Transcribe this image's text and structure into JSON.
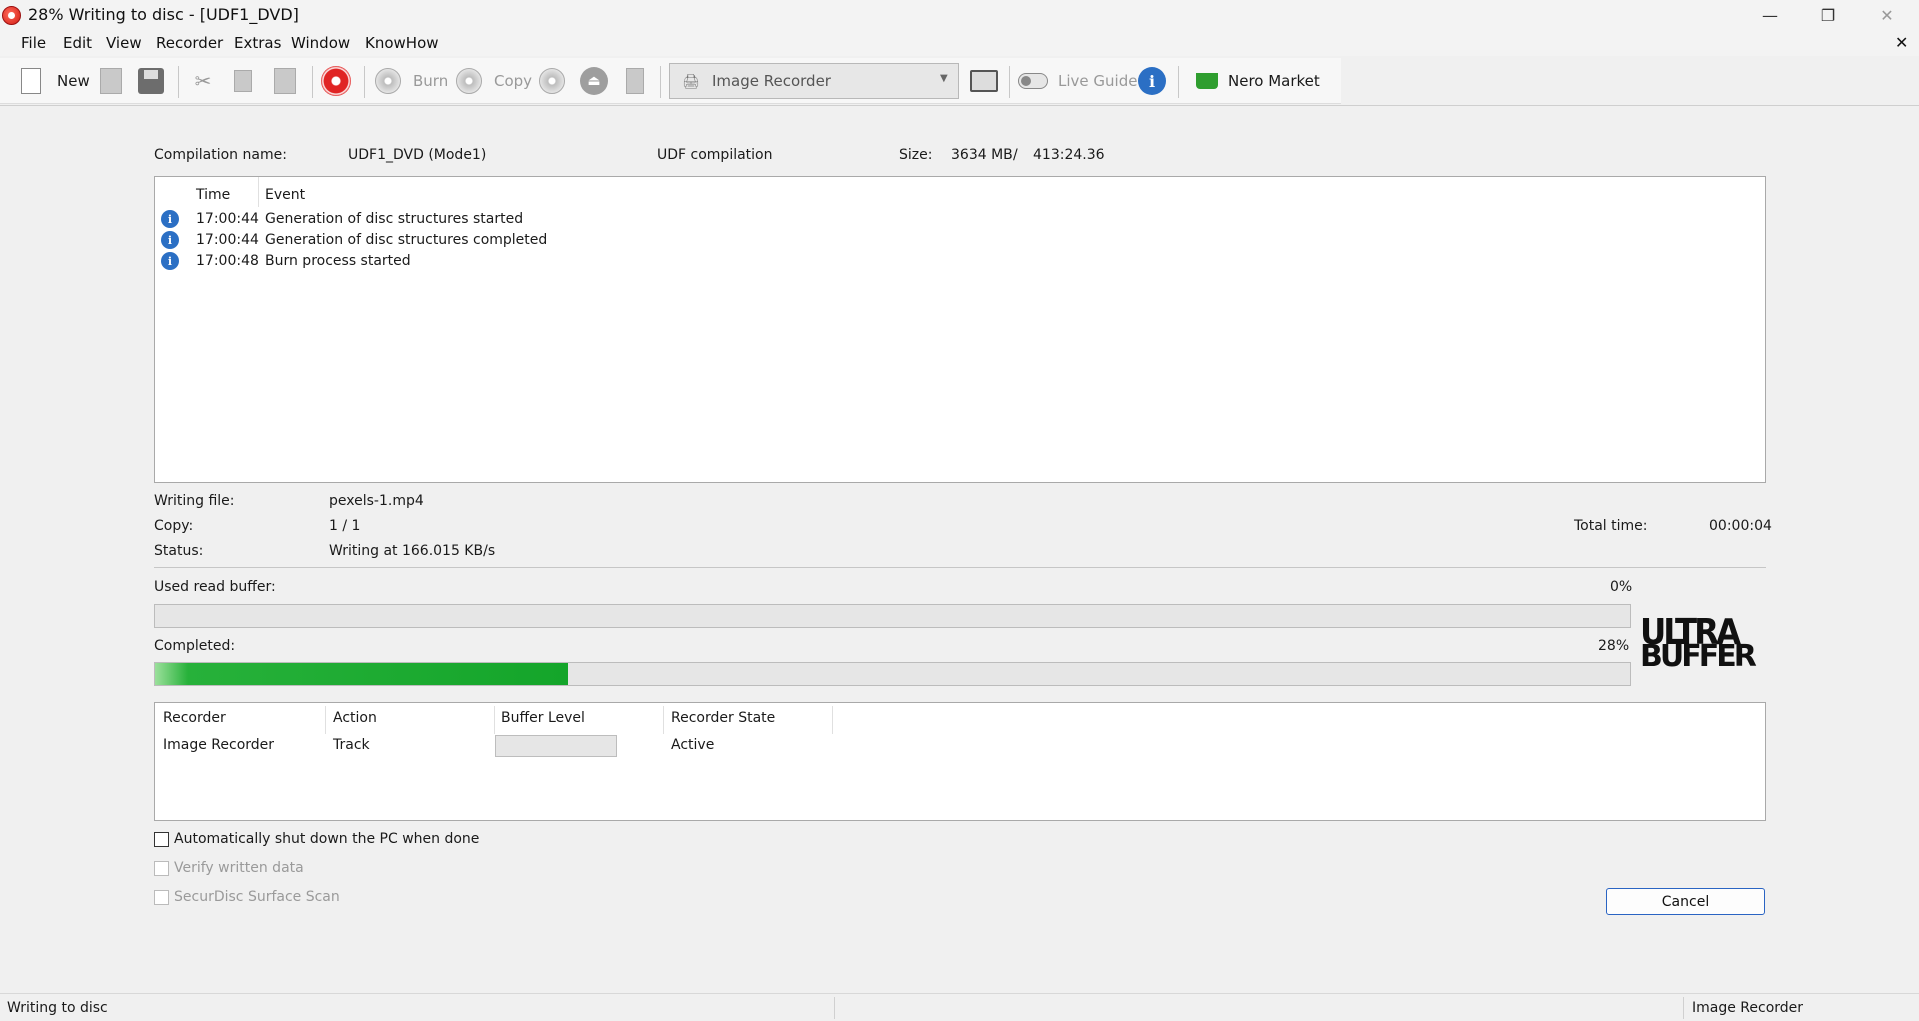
{
  "window": {
    "title": "28% Writing to disc - [UDF1_DVD]",
    "minimize_glyph": "—",
    "maximize_glyph": "❐",
    "close_glyph": "✕"
  },
  "menu": {
    "items": [
      "File",
      "Edit",
      "View",
      "Recorder",
      "Extras",
      "Window",
      "KnowHow"
    ],
    "doc_close_glyph": "✕"
  },
  "toolbar": {
    "new_label": "New",
    "burn_label": "Burn",
    "copy_label": "Copy",
    "recorder_select": "Image Recorder",
    "live_guide_label": "Live Guide",
    "market_label": "Nero Market",
    "more_glyph": "▾"
  },
  "compilation": {
    "name_label": "Compilation name:",
    "name_value": "UDF1_DVD (Mode1)",
    "type": "UDF compilation",
    "size_label": "Size:",
    "size_mb": "3634 MB",
    "size_sep": "/",
    "size_time": "413:24.36"
  },
  "log": {
    "columns": [
      "Time",
      "Event"
    ],
    "rows": [
      {
        "time": "17:00:44",
        "event": "Generation of disc structures started"
      },
      {
        "time": "17:00:44",
        "event": "Generation of disc structures completed"
      },
      {
        "time": "17:00:48",
        "event": "Burn process started"
      }
    ]
  },
  "details": {
    "writing_file_label": "Writing file:",
    "writing_file_value": "pexels-1.mp4",
    "copy_label": "Copy:",
    "copy_value": "1 / 1",
    "status_label": "Status:",
    "status_value": "Writing at 166.015 KB/s",
    "total_time_label": "Total time:",
    "total_time_value": "00:00:04"
  },
  "read_buffer": {
    "label": "Used read buffer:",
    "percent_text": "0%",
    "fraction": 0.0
  },
  "completed": {
    "label": "Completed:",
    "percent_text": "28%",
    "fraction": 0.28
  },
  "logo": {
    "line1": "ULTRA",
    "line2": "BUFFER"
  },
  "recorders": {
    "columns": [
      "Recorder",
      "Action",
      "Buffer Level",
      "Recorder State"
    ],
    "rows": [
      {
        "recorder": "Image Recorder",
        "action": "Track",
        "buffer_fraction": 0.0,
        "state": "Active"
      }
    ]
  },
  "options": {
    "shutdown": "Automatically shut down the PC when done",
    "verify": "Verify written data",
    "securdisc": "SecurDisc Surface Scan"
  },
  "buttons": {
    "cancel": "Cancel"
  },
  "statusbar": {
    "left": "Writing to disc",
    "right": "Image Recorder"
  },
  "colors": {
    "progress_green": "#14a52a",
    "accent_blue": "#2a64c3",
    "brand_red": "#d21c13"
  }
}
